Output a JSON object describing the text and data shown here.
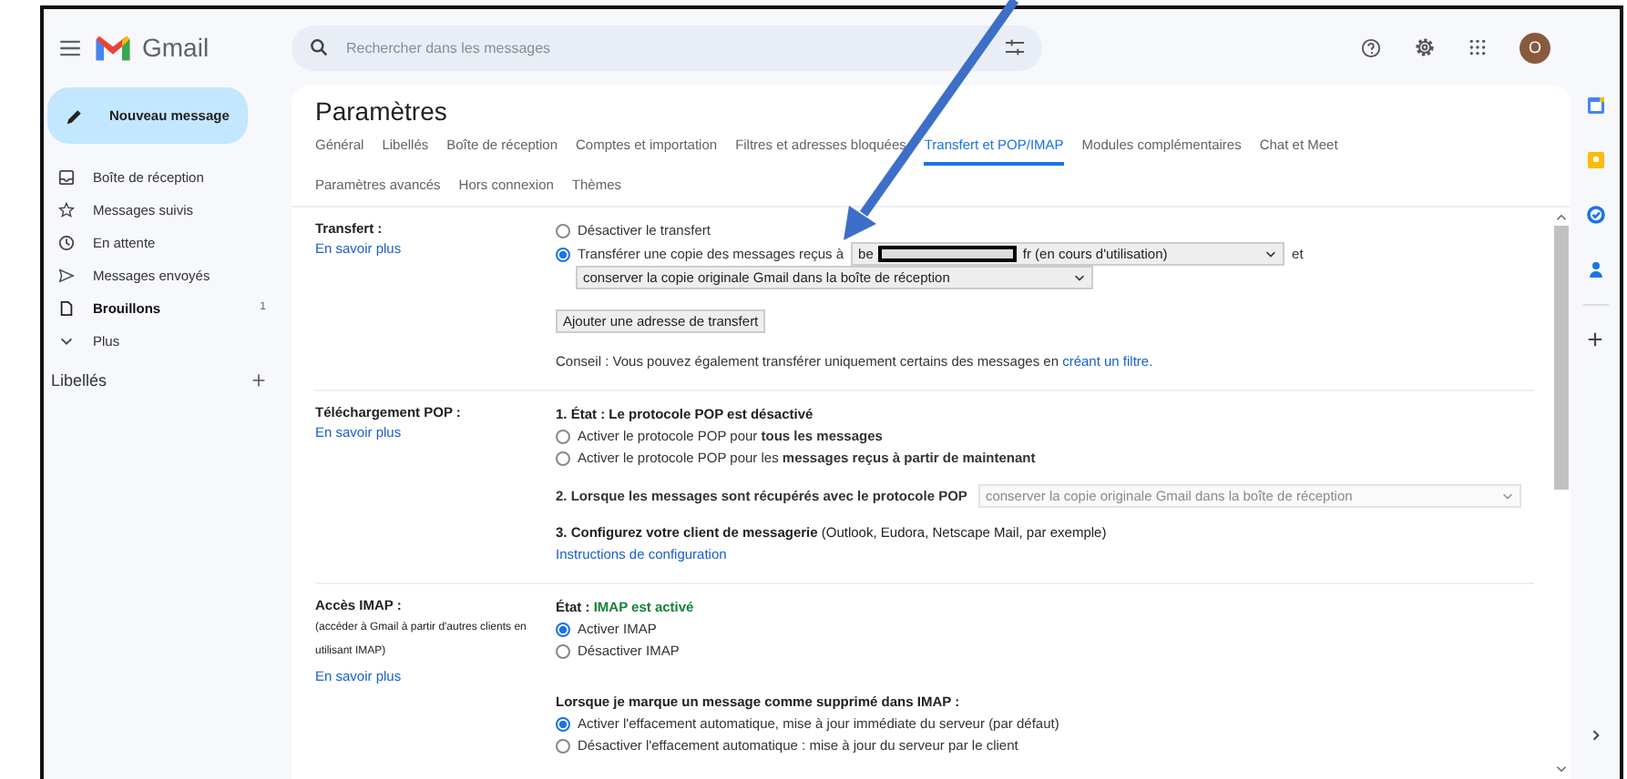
{
  "app": {
    "name": "Gmail",
    "search": {
      "placeholder": "Rechercher dans les messages"
    },
    "avatar": "O"
  },
  "compose": "Nouveau message",
  "sidebar": {
    "items": [
      {
        "label": "Boîte de réception",
        "bold": false
      },
      {
        "label": "Messages suivis",
        "bold": false
      },
      {
        "label": "En attente",
        "bold": false
      },
      {
        "label": "Messages envoyés",
        "bold": false
      },
      {
        "label": "Brouillons",
        "bold": true,
        "count": "1"
      },
      {
        "label": "Plus",
        "bold": false
      }
    ],
    "labels_title": "Libellés"
  },
  "settings": {
    "title": "Paramètres",
    "tab_rows": [
      [
        {
          "label": "Général",
          "selected": false
        },
        {
          "label": "Libellés",
          "selected": false
        },
        {
          "label": "Boîte de réception",
          "selected": false
        },
        {
          "label": "Comptes et importation",
          "selected": false
        },
        {
          "label": "Filtres et adresses bloquées",
          "selected": false
        },
        {
          "label": "Transfert et POP/IMAP",
          "selected": true
        },
        {
          "label": "Modules complémentaires",
          "selected": false
        },
        {
          "label": "Chat et Meet",
          "selected": false
        }
      ],
      [
        {
          "label": "Paramètres avancés",
          "selected": false
        },
        {
          "label": "Hors connexion",
          "selected": false
        },
        {
          "label": "Thèmes",
          "selected": false
        }
      ]
    ],
    "forwarding": {
      "label": "Transfert :",
      "link": "En savoir plus",
      "options": [
        {
          "text": "Désactiver le transfert",
          "selected": false
        },
        {
          "text": "Transférer une copie des messages reçus à",
          "selected": true
        }
      ],
      "address_start": "be",
      "address_end": "fr (en cours d'utilisation)",
      "after": "et",
      "keep_select": "conserver la copie originale Gmail dans la boîte de réception",
      "add_button": "Ajouter une adresse de transfert",
      "tip": "Conseil : Vous pouvez également transférer uniquement certains des messages en",
      "tip_link": "créant un filtre."
    },
    "pop": {
      "label": "Téléchargement POP :",
      "link": "En savoir plus",
      "status": "1. État : Le protocole POP est désactivé",
      "options": [
        {
          "text": "Activer le protocole POP pour **tous les messages**",
          "selected": false
        },
        {
          "text": "Activer le protocole POP pour les **messages reçus à partir de maintenant**",
          "selected": false
        }
      ],
      "step2": "2. Lorsque les messages sont récupérés avec le protocole POP",
      "step2_select": {
        "value": "conserver la copie originale Gmail dans la boîte de réception",
        "disabled": true
      },
      "step3": "**3. Configurez votre client de messagerie** (Outlook, Eudora, Netscape Mail, par exemple)",
      "step3_link": "Instructions de configuration"
    },
    "imap": {
      "label": "Accès IMAP :",
      "note": "(accéder à Gmail à partir d'autres clients en utilisant IMAP)",
      "link": "En savoir plus",
      "status_label": "État :",
      "status_value": "IMAP est activé",
      "options": [
        {
          "text": "Activer IMAP",
          "selected": true
        },
        {
          "text": "Désactiver IMAP",
          "selected": false
        }
      ],
      "delete_title": "Lorsque je marque un message comme supprimé dans IMAP :",
      "delete_options": [
        {
          "text": "Activer l'effacement automatique, mise à jour immédiate du serveur (par défaut)",
          "selected": true
        },
        {
          "text": "Désactiver l'effacement automatique : mise à jour du serveur par le client",
          "selected": false
        }
      ]
    }
  }
}
